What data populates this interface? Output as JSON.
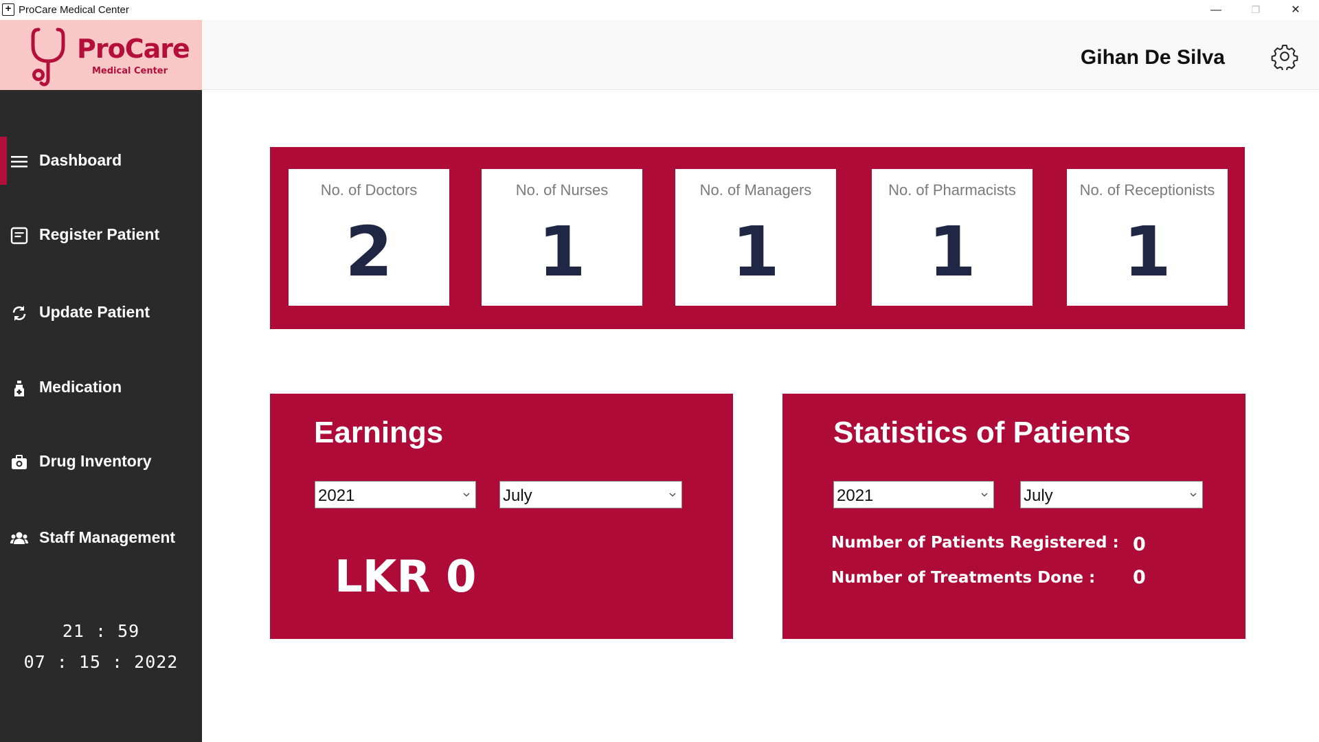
{
  "window": {
    "title": "ProCare Medical Center",
    "controls": {
      "minimize": "—",
      "maximize": "❐",
      "close": "✕"
    }
  },
  "logo": {
    "name": "ProCare",
    "subtitle": "Medical Center",
    "icon": "stethoscope-icon"
  },
  "header": {
    "user_name": "Gihan De Silva",
    "settings_icon": "gear-icon"
  },
  "sidebar": {
    "items": [
      {
        "label": "Dashboard",
        "icon": "menu-icon",
        "active": true
      },
      {
        "label": "Register Patient",
        "icon": "clipboard-icon",
        "active": false
      },
      {
        "label": "Update Patient",
        "icon": "refresh-icon",
        "active": false
      },
      {
        "label": "Medication",
        "icon": "medicine-bottle-icon",
        "active": false
      },
      {
        "label": "Drug Inventory",
        "icon": "medical-kit-icon",
        "active": false
      },
      {
        "label": "Staff Management",
        "icon": "users-icon",
        "active": false
      }
    ],
    "clock": {
      "time": "21 : 59",
      "date": "07 : 15 : 2022"
    }
  },
  "staff_counts": [
    {
      "label": "No. of Doctors",
      "value": "2"
    },
    {
      "label": "No. of Nurses",
      "value": "1"
    },
    {
      "label": "No. of Managers",
      "value": "1"
    },
    {
      "label": "No. of Pharmacists",
      "value": "1"
    },
    {
      "label": "No. of Receptionists",
      "value": "1"
    }
  ],
  "earnings": {
    "title": "Earnings",
    "year": "2021",
    "month": "July",
    "amount": "LKR 0"
  },
  "patient_stats": {
    "title": "Statistics of Patients",
    "year": "2021",
    "month": "July",
    "registered_label": "Number of Patients Registered :",
    "registered_value": "0",
    "treatments_label": "Number of Treatments Done :",
    "treatments_value": "0"
  },
  "colors": {
    "brand": "#ae0b38",
    "sidebar_bg": "#2b2a2b",
    "logo_bg": "#f9c7c5",
    "stat_value": "#1f2744"
  }
}
